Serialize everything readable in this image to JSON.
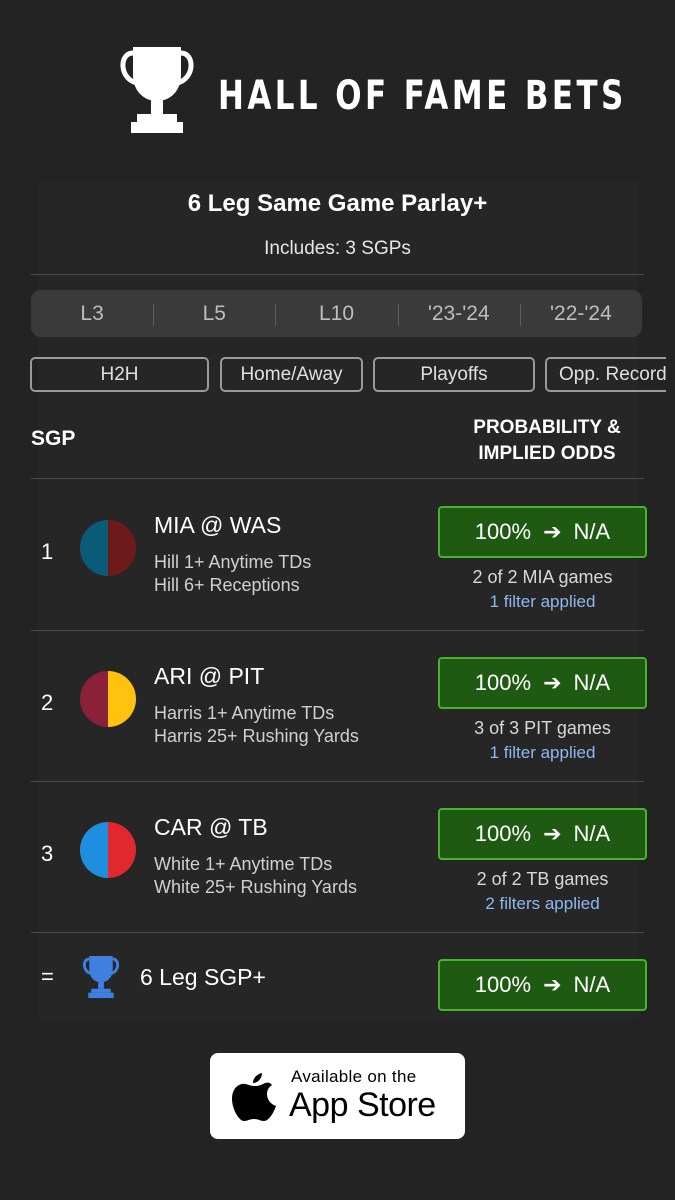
{
  "brand": {
    "name": "HALL OF FAME BETS",
    "icon": "trophy-icon"
  },
  "header": {
    "title": "6 Leg Same Game Parlay+",
    "subtitle": "Includes: 3 SGPs"
  },
  "ranges": [
    "L3",
    "L5",
    "L10",
    "'23-'24",
    "'22-'24"
  ],
  "filters": [
    "H2H",
    "Home/Away",
    "Playoffs",
    "Opp. Record"
  ],
  "columns": {
    "sgp": "SGP",
    "prob_line1": "PROBABILITY &",
    "prob_line2": "IMPLIED ODDS"
  },
  "rows": [
    {
      "num": "1",
      "matchup": "MIA @ WAS",
      "legs": [
        "Hill 1+ Anytime TDs",
        "Hill 6+ Receptions"
      ],
      "colors": [
        "#0a5b78",
        "#6e1a1a"
      ],
      "probability": "100%",
      "odds": "N/A",
      "games": "2 of 2 MIA games",
      "filters": "1 filter applied"
    },
    {
      "num": "2",
      "matchup": "ARI @ PIT",
      "legs": [
        "Harris 1+ Anytime TDs",
        "Harris 25+ Rushing Yards"
      ],
      "colors": [
        "#8b2139",
        "#ffc20e"
      ],
      "probability": "100%",
      "odds": "N/A",
      "games": "3 of 3 PIT games",
      "filters": "1 filter applied"
    },
    {
      "num": "3",
      "matchup": "CAR @ TB",
      "legs": [
        "White 1+ Anytime TDs",
        "White 25+ Rushing Yards"
      ],
      "colors": [
        "#1e8fde",
        "#e2282f"
      ],
      "probability": "100%",
      "odds": "N/A",
      "games": "2 of 2 TB games",
      "filters": "2 filters applied"
    }
  ],
  "total": {
    "eq": "=",
    "label": "6 Leg SGP+",
    "probability": "100%",
    "odds": "N/A",
    "icon": "trophy-icon",
    "icon_color": "#3f7fe0"
  },
  "appstore": {
    "line1": "Available on the",
    "line2": "App Store",
    "icon": "apple-icon"
  },
  "colors": {
    "background": "#232323",
    "odds_green": "#1f5a12",
    "odds_border": "#45b52e",
    "link_blue": "#8eb8f2"
  }
}
